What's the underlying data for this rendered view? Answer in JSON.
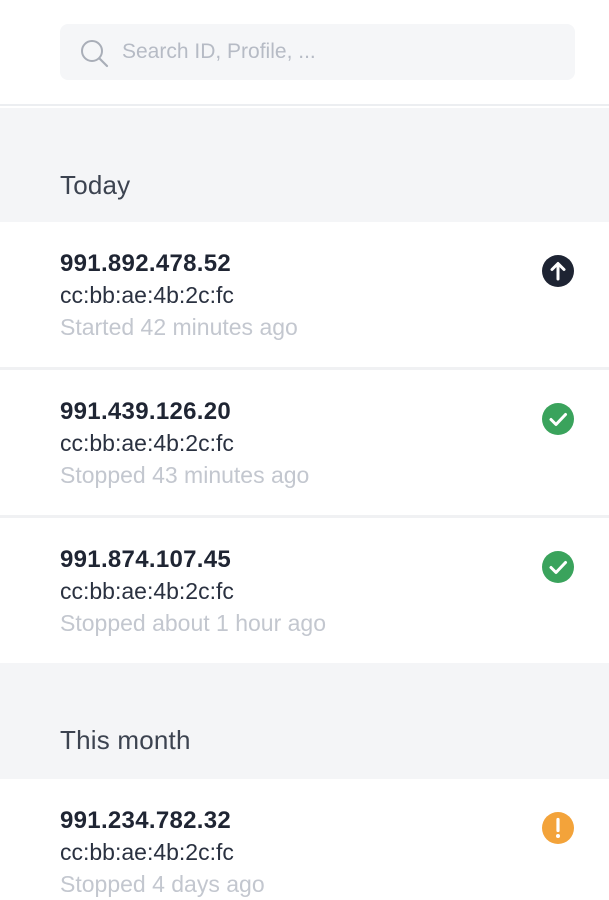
{
  "search": {
    "placeholder": "Search ID, Profile, ..."
  },
  "groups": [
    {
      "label": "Today",
      "items": [
        {
          "ip": "991.892.478.52",
          "mac": "cc:bb:ae:4b:2c:fc",
          "status": "Started 42 minutes ago",
          "icon": "upload-arrow-icon",
          "icon_color": "#1e2433"
        },
        {
          "ip": "991.439.126.20",
          "mac": "cc:bb:ae:4b:2c:fc",
          "status": "Stopped 43 minutes ago",
          "icon": "check-circle-icon",
          "icon_color": "#3aa35c"
        },
        {
          "ip": "991.874.107.45",
          "mac": "cc:bb:ae:4b:2c:fc",
          "status": "Stopped about 1 hour ago",
          "icon": "check-circle-icon",
          "icon_color": "#3aa35c"
        }
      ]
    },
    {
      "label": "This month",
      "items": [
        {
          "ip": "991.234.782.32",
          "mac": "cc:bb:ae:4b:2c:fc",
          "status": "Stopped 4 days ago",
          "icon": "warning-circle-icon",
          "icon_color": "#f3a33a"
        }
      ]
    }
  ]
}
